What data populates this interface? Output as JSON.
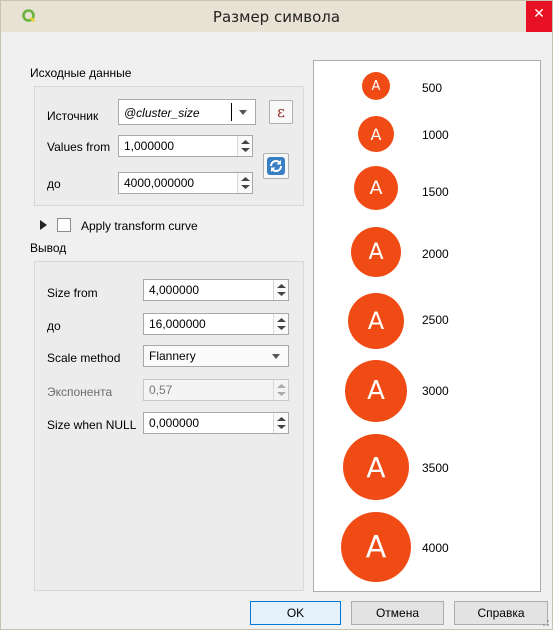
{
  "window": {
    "title": "Размер символа",
    "close": "✕"
  },
  "source_group": {
    "title": "Исходные данные",
    "source_label": "Источник",
    "source_value": "@cluster_size",
    "values_from_label": "Values from",
    "values_from": "1,000000",
    "to_label": "до",
    "to_value": "4000,000000"
  },
  "transform": {
    "label": "Apply transform curve",
    "checked": false
  },
  "output_group": {
    "title": "Вывод",
    "size_from_label": "Size from",
    "size_from": "4,000000",
    "size_to_label": "до",
    "size_to": "16,000000",
    "scale_method_label": "Scale method",
    "scale_method": "Flannery",
    "exponent_label": "Экспонента",
    "exponent": "0,57",
    "size_null_label": "Size when NULL",
    "size_null": "0,000000"
  },
  "preview": {
    "symbol_letter": "A",
    "symbol_color": "#f04b14",
    "items": [
      {
        "letter": "A",
        "value": "500"
      },
      {
        "letter": "A",
        "value": "1000"
      },
      {
        "letter": "A",
        "value": "1500"
      },
      {
        "letter": "A",
        "value": "2000"
      },
      {
        "letter": "A",
        "value": "2500"
      },
      {
        "letter": "A",
        "value": "3000"
      },
      {
        "letter": "A",
        "value": "3500"
      },
      {
        "letter": "A",
        "value": "4000"
      }
    ]
  },
  "buttons": {
    "ok": "OK",
    "cancel": "Отмена",
    "help": "Справка"
  },
  "icons": {
    "app": "qgis-logo-icon",
    "expression": "epsilon-expression-icon",
    "refresh": "refresh-icon",
    "expand": "expand-arrow-icon"
  }
}
